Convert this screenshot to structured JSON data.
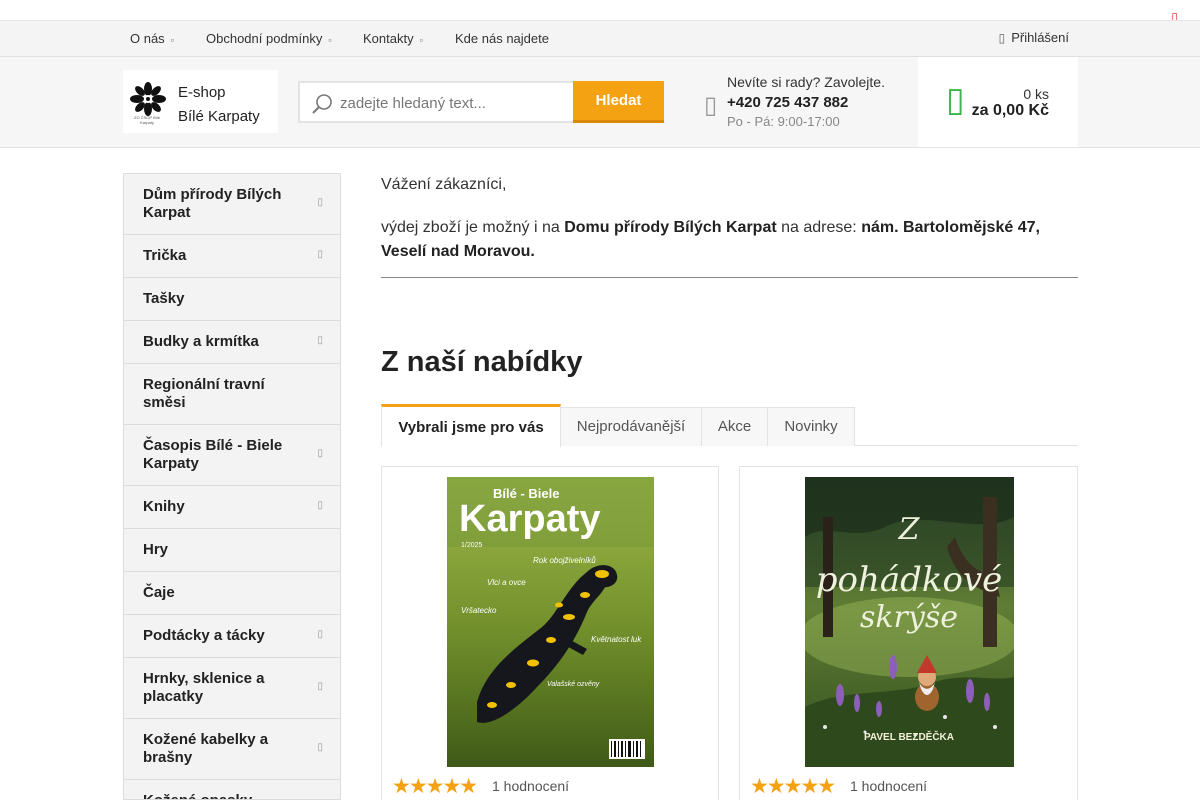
{
  "top_nav": {
    "items": [
      {
        "label": "O nás",
        "has_dropdown": true
      },
      {
        "label": "Obchodní podmínky",
        "has_dropdown": true
      },
      {
        "label": "Kontakty",
        "has_dropdown": true
      },
      {
        "label": "Kde nás najdete",
        "has_dropdown": false
      }
    ],
    "login_label": "Přihlášení",
    "dropdown_glyph": "▫",
    "user_glyph": "▯",
    "close_glyph": "▯"
  },
  "header": {
    "logo": {
      "line1": "E-shop",
      "line2": "Bílé Karpaty",
      "sub": "ZO ČSOP Bílé Karpaty"
    },
    "search": {
      "placeholder": "zadejte hledaný text...",
      "button_label": "Hledat"
    },
    "contact": {
      "help_text": "Nevíte si rady? Zavolejte.",
      "phone": "+420 725 437 882",
      "hours": "Po - Pá: 9:00-17:00",
      "icon_glyph": "▯"
    },
    "cart": {
      "count": "0 ks",
      "total": "za 0,00 Kč",
      "icon_glyph": "▯"
    }
  },
  "sidebar": {
    "arrow_glyph": "▯",
    "categories": [
      {
        "label": "Dům přírody Bílých Karpat",
        "has_children": true
      },
      {
        "label": "Trička",
        "has_children": true
      },
      {
        "label": "Tašky",
        "has_children": false
      },
      {
        "label": "Budky a krmítka",
        "has_children": true
      },
      {
        "label": "Regionální travní směsi",
        "has_children": false
      },
      {
        "label": "Časopis Bílé - Biele Karpaty",
        "has_children": true
      },
      {
        "label": "Knihy",
        "has_children": true
      },
      {
        "label": "Hry",
        "has_children": false
      },
      {
        "label": "Čaje",
        "has_children": false
      },
      {
        "label": "Podtácky a tácky",
        "has_children": true
      },
      {
        "label": "Hrnky, sklenice a placatky",
        "has_children": true
      },
      {
        "label": "Kožené kabelky a brašny",
        "has_children": true
      },
      {
        "label": "Kožené opasky",
        "has_children": false
      }
    ]
  },
  "main": {
    "greeting": "Vážení zákazníci,",
    "notice_prefix": "výdej zboží je možný i na ",
    "notice_place": "Domu přírody Bílých Karpat",
    "notice_middle": " na adrese: ",
    "notice_address": "nám. Bartolomějské 47, Veselí nad Moravou.",
    "section_title": "Z naší nabídky",
    "tabs": [
      {
        "label": "Vybrali jsme pro vás",
        "active": true
      },
      {
        "label": "Nejprodávanější",
        "active": false
      },
      {
        "label": "Akce",
        "active": false
      },
      {
        "label": "Novinky",
        "active": false
      }
    ],
    "products": [
      {
        "cover_title": "Karpaty",
        "cover_top": "Bílé - Biele",
        "cover_issue": "1/2025",
        "cover_headlines": [
          "Rok obojživelníků",
          "Vlci a ovce",
          "Vršatecko",
          "Květnatost luk",
          "Valašské ozvěny"
        ],
        "rating_stars": 5,
        "rating_text": "1 hodnocení"
      },
      {
        "cover_title_line1": "Z",
        "cover_title_line2": "pohádkové",
        "cover_title_line3": "skrýše",
        "cover_author": "PAVEL BEZDĚČKA",
        "rating_stars": 5,
        "rating_text": "1 hodnocení"
      }
    ]
  },
  "colors": {
    "accent": "#f5a212",
    "cart_green": "#39b54a",
    "close_red": "#e03a2f",
    "salamander_yellow": "#f2c200"
  }
}
